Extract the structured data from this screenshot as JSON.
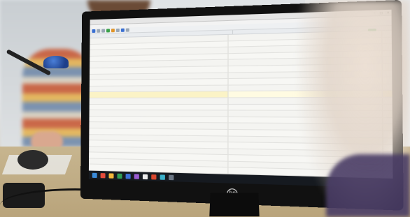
{
  "monitor": {
    "brand_logo": "hp",
    "app": {
      "window_title": "",
      "menu": [
        "",
        "",
        "",
        "",
        ""
      ],
      "columns": {
        "source": "",
        "target": ""
      },
      "rows": [
        {
          "src": "",
          "tgt": "",
          "status": "",
          "active": false
        },
        {
          "src": "",
          "tgt": "",
          "status": "",
          "active": false
        },
        {
          "src": "",
          "tgt": "",
          "status": "",
          "active": false
        },
        {
          "src": "",
          "tgt": "",
          "status": "",
          "active": false
        },
        {
          "src": "",
          "tgt": "",
          "status": "",
          "active": false
        },
        {
          "src": "",
          "tgt": "",
          "status": "",
          "active": false
        },
        {
          "src": "",
          "tgt": "",
          "status": "",
          "active": false
        },
        {
          "src": "",
          "tgt": "",
          "status": "",
          "active": false
        },
        {
          "src": "",
          "tgt": "",
          "status": "",
          "active": false
        },
        {
          "src": "",
          "tgt": "",
          "status": "",
          "active": true
        },
        {
          "src": "",
          "tgt": "",
          "status": "",
          "active": false
        },
        {
          "src": "",
          "tgt": "",
          "status": "",
          "active": false
        },
        {
          "src": "",
          "tgt": "",
          "status": "",
          "active": false
        },
        {
          "src": "",
          "tgt": "",
          "status": "",
          "active": false
        },
        {
          "src": "",
          "tgt": "",
          "status": "",
          "active": false
        },
        {
          "src": "",
          "tgt": "",
          "status": "",
          "active": false
        },
        {
          "src": "",
          "tgt": "",
          "status": "",
          "active": false
        },
        {
          "src": "",
          "tgt": "",
          "status": "",
          "active": false
        },
        {
          "src": "",
          "tgt": "",
          "status": "",
          "active": false
        },
        {
          "src": "",
          "tgt": "",
          "status": "",
          "active": false
        },
        {
          "src": "",
          "tgt": "",
          "status": "",
          "active": false
        },
        {
          "src": "",
          "tgt": "",
          "status": "",
          "active": false
        }
      ],
      "taskbar_icons": [
        "windows-start-icon",
        "browser-icon",
        "folder-icon",
        "spreadsheet-icon",
        "word-icon",
        "purple-app-icon",
        "notepad-icon",
        "red-app-icon",
        "cyan-app-icon",
        "settings-icon"
      ]
    }
  },
  "colors": {
    "active_row": "#fbf3c6",
    "status_green": "#3aa14a",
    "taskbar": "#161a20"
  }
}
